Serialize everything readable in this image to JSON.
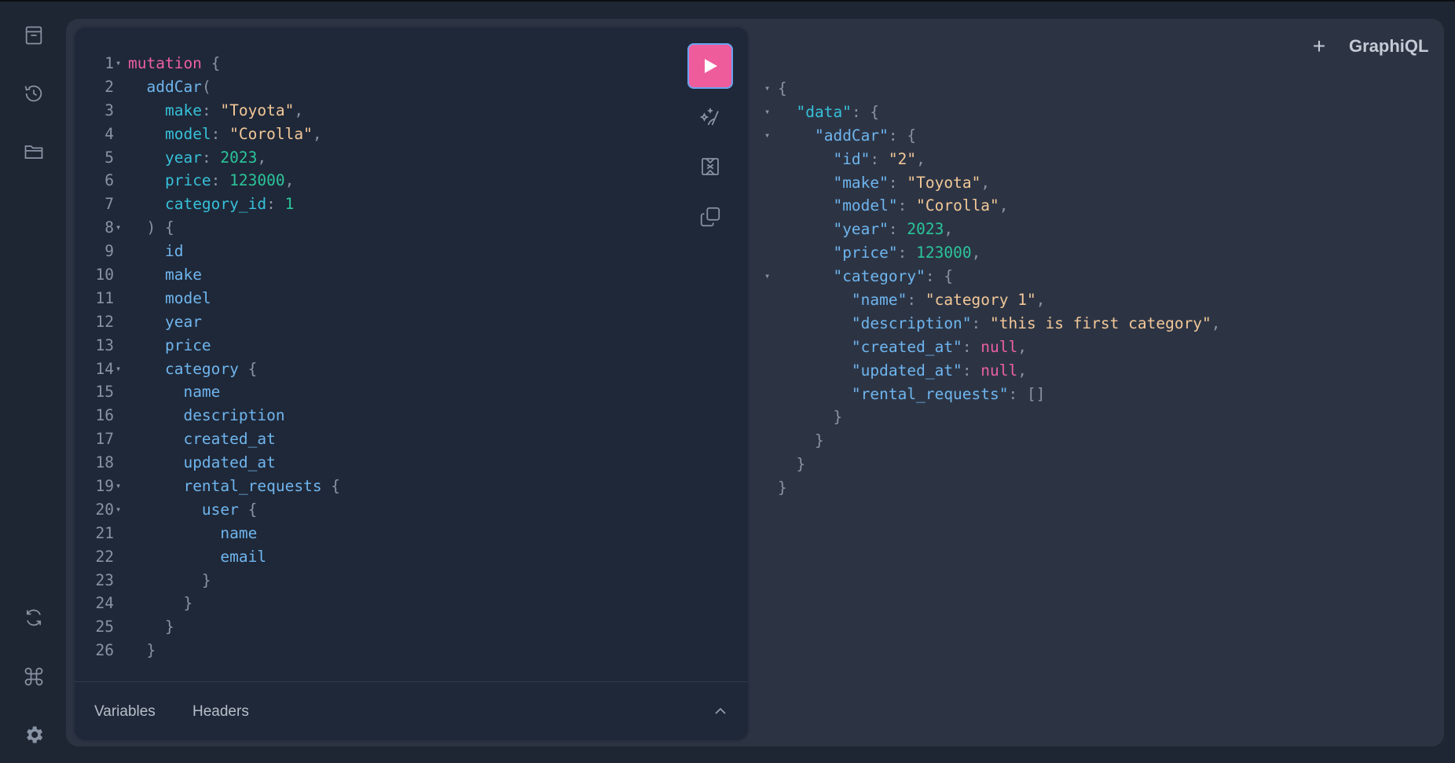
{
  "app": {
    "logo": "GraphiQL",
    "add_tab_label": "+"
  },
  "sidebar": {
    "top_icons": [
      "docs-icon",
      "history-icon",
      "explorer-icon"
    ],
    "bottom_icons": [
      "refetch-schema-icon",
      "shortcuts-icon",
      "settings-icon"
    ]
  },
  "toolbar": {
    "run_icon": "play-icon",
    "prettify_icon": "prettify-icon",
    "merge_icon": "merge-fragments-icon",
    "copy_icon": "copy-icon"
  },
  "editor": {
    "lines": [
      {
        "n": "1",
        "fold": true,
        "indent": 0,
        "tokens": [
          [
            "kw",
            "mutation"
          ],
          [
            "brace",
            " {"
          ]
        ]
      },
      {
        "n": "2",
        "fold": false,
        "indent": 1,
        "tokens": [
          [
            "fld",
            "addCar"
          ],
          [
            "brace",
            "("
          ]
        ]
      },
      {
        "n": "3",
        "fold": false,
        "indent": 2,
        "tokens": [
          [
            "arg",
            "make"
          ],
          [
            "punc",
            ": "
          ],
          [
            "str",
            "\"Toyota\""
          ],
          [
            "punc",
            ","
          ]
        ]
      },
      {
        "n": "4",
        "fold": false,
        "indent": 2,
        "tokens": [
          [
            "arg",
            "model"
          ],
          [
            "punc",
            ": "
          ],
          [
            "str",
            "\"Corolla\""
          ],
          [
            "punc",
            ","
          ]
        ]
      },
      {
        "n": "5",
        "fold": false,
        "indent": 2,
        "tokens": [
          [
            "arg",
            "year"
          ],
          [
            "punc",
            ": "
          ],
          [
            "num",
            "2023"
          ],
          [
            "punc",
            ","
          ]
        ]
      },
      {
        "n": "6",
        "fold": false,
        "indent": 2,
        "tokens": [
          [
            "arg",
            "price"
          ],
          [
            "punc",
            ": "
          ],
          [
            "num",
            "123000"
          ],
          [
            "punc",
            ","
          ]
        ]
      },
      {
        "n": "7",
        "fold": false,
        "indent": 2,
        "tokens": [
          [
            "arg",
            "category_id"
          ],
          [
            "punc",
            ": "
          ],
          [
            "num",
            "1"
          ]
        ]
      },
      {
        "n": "8",
        "fold": true,
        "indent": 1,
        "tokens": [
          [
            "brace",
            ") {"
          ]
        ]
      },
      {
        "n": "9",
        "fold": false,
        "indent": 2,
        "tokens": [
          [
            "fld",
            "id"
          ]
        ]
      },
      {
        "n": "10",
        "fold": false,
        "indent": 2,
        "tokens": [
          [
            "fld",
            "make"
          ]
        ]
      },
      {
        "n": "11",
        "fold": false,
        "indent": 2,
        "tokens": [
          [
            "fld",
            "model"
          ]
        ]
      },
      {
        "n": "12",
        "fold": false,
        "indent": 2,
        "tokens": [
          [
            "fld",
            "year"
          ]
        ]
      },
      {
        "n": "13",
        "fold": false,
        "indent": 2,
        "tokens": [
          [
            "fld",
            "price"
          ]
        ]
      },
      {
        "n": "14",
        "fold": true,
        "indent": 2,
        "tokens": [
          [
            "fld",
            "category"
          ],
          [
            "brace",
            " {"
          ]
        ]
      },
      {
        "n": "15",
        "fold": false,
        "indent": 3,
        "tokens": [
          [
            "fld",
            "name"
          ]
        ]
      },
      {
        "n": "16",
        "fold": false,
        "indent": 3,
        "tokens": [
          [
            "fld",
            "description"
          ]
        ]
      },
      {
        "n": "17",
        "fold": false,
        "indent": 3,
        "tokens": [
          [
            "fld",
            "created_at"
          ]
        ]
      },
      {
        "n": "18",
        "fold": false,
        "indent": 3,
        "tokens": [
          [
            "fld",
            "updated_at"
          ]
        ]
      },
      {
        "n": "19",
        "fold": true,
        "indent": 3,
        "tokens": [
          [
            "fld",
            "rental_requests"
          ],
          [
            "brace",
            " {"
          ]
        ]
      },
      {
        "n": "20",
        "fold": true,
        "indent": 4,
        "tokens": [
          [
            "fld",
            "user"
          ],
          [
            "brace",
            " {"
          ]
        ]
      },
      {
        "n": "21",
        "fold": false,
        "indent": 5,
        "tokens": [
          [
            "fld",
            "name"
          ]
        ]
      },
      {
        "n": "22",
        "fold": false,
        "indent": 5,
        "tokens": [
          [
            "fld",
            "email"
          ]
        ]
      },
      {
        "n": "23",
        "fold": false,
        "indent": 4,
        "tokens": [
          [
            "brace",
            "}"
          ]
        ]
      },
      {
        "n": "24",
        "fold": false,
        "indent": 3,
        "tokens": [
          [
            "brace",
            "}"
          ]
        ]
      },
      {
        "n": "25",
        "fold": false,
        "indent": 2,
        "tokens": [
          [
            "brace",
            "}"
          ]
        ]
      },
      {
        "n": "26",
        "fold": false,
        "indent": 1,
        "tokens": [
          [
            "brace",
            "}"
          ]
        ]
      }
    ]
  },
  "bottom": {
    "variables_label": "Variables",
    "headers_label": "Headers"
  },
  "result": {
    "lines": [
      {
        "fold": true,
        "indent": 0,
        "tokens": [
          [
            "brace",
            "{"
          ]
        ]
      },
      {
        "fold": true,
        "indent": 1,
        "tokens": [
          [
            "arg",
            "\"data\""
          ],
          [
            "punc",
            ": "
          ],
          [
            "brace",
            "{"
          ]
        ]
      },
      {
        "fold": true,
        "indent": 2,
        "tokens": [
          [
            "fld",
            "\"addCar\""
          ],
          [
            "punc",
            ": "
          ],
          [
            "brace",
            "{"
          ]
        ]
      },
      {
        "fold": false,
        "indent": 3,
        "tokens": [
          [
            "fld",
            "\"id\""
          ],
          [
            "punc",
            ": "
          ],
          [
            "str",
            "\"2\""
          ],
          [
            "punc",
            ","
          ]
        ]
      },
      {
        "fold": false,
        "indent": 3,
        "tokens": [
          [
            "fld",
            "\"make\""
          ],
          [
            "punc",
            ": "
          ],
          [
            "str",
            "\"Toyota\""
          ],
          [
            "punc",
            ","
          ]
        ]
      },
      {
        "fold": false,
        "indent": 3,
        "tokens": [
          [
            "fld",
            "\"model\""
          ],
          [
            "punc",
            ": "
          ],
          [
            "str",
            "\"Corolla\""
          ],
          [
            "punc",
            ","
          ]
        ]
      },
      {
        "fold": false,
        "indent": 3,
        "tokens": [
          [
            "fld",
            "\"year\""
          ],
          [
            "punc",
            ": "
          ],
          [
            "num",
            "2023"
          ],
          [
            "punc",
            ","
          ]
        ]
      },
      {
        "fold": false,
        "indent": 3,
        "tokens": [
          [
            "fld",
            "\"price\""
          ],
          [
            "punc",
            ": "
          ],
          [
            "num",
            "123000"
          ],
          [
            "punc",
            ","
          ]
        ]
      },
      {
        "fold": true,
        "indent": 3,
        "tokens": [
          [
            "fld",
            "\"category\""
          ],
          [
            "punc",
            ": "
          ],
          [
            "brace",
            "{"
          ]
        ]
      },
      {
        "fold": false,
        "indent": 4,
        "tokens": [
          [
            "fld",
            "\"name\""
          ],
          [
            "punc",
            ": "
          ],
          [
            "str",
            "\"category 1\""
          ],
          [
            "punc",
            ","
          ]
        ]
      },
      {
        "fold": false,
        "indent": 4,
        "tokens": [
          [
            "fld",
            "\"description\""
          ],
          [
            "punc",
            ": "
          ],
          [
            "str",
            "\"this is first category\""
          ],
          [
            "punc",
            ","
          ]
        ]
      },
      {
        "fold": false,
        "indent": 4,
        "tokens": [
          [
            "fld",
            "\"created_at\""
          ],
          [
            "punc",
            ": "
          ],
          [
            "null",
            "null"
          ],
          [
            "punc",
            ","
          ]
        ]
      },
      {
        "fold": false,
        "indent": 4,
        "tokens": [
          [
            "fld",
            "\"updated_at\""
          ],
          [
            "punc",
            ": "
          ],
          [
            "null",
            "null"
          ],
          [
            "punc",
            ","
          ]
        ]
      },
      {
        "fold": false,
        "indent": 4,
        "tokens": [
          [
            "fld",
            "\"rental_requests\""
          ],
          [
            "punc",
            ": "
          ],
          [
            "brace",
            "[]"
          ]
        ]
      },
      {
        "fold": false,
        "indent": 3,
        "tokens": [
          [
            "brace",
            "}"
          ]
        ]
      },
      {
        "fold": false,
        "indent": 2,
        "tokens": [
          [
            "brace",
            "}"
          ]
        ]
      },
      {
        "fold": false,
        "indent": 1,
        "tokens": [
          [
            "brace",
            "}"
          ]
        ]
      },
      {
        "fold": false,
        "indent": 0,
        "tokens": [
          [
            "brace",
            "}"
          ]
        ]
      }
    ]
  }
}
